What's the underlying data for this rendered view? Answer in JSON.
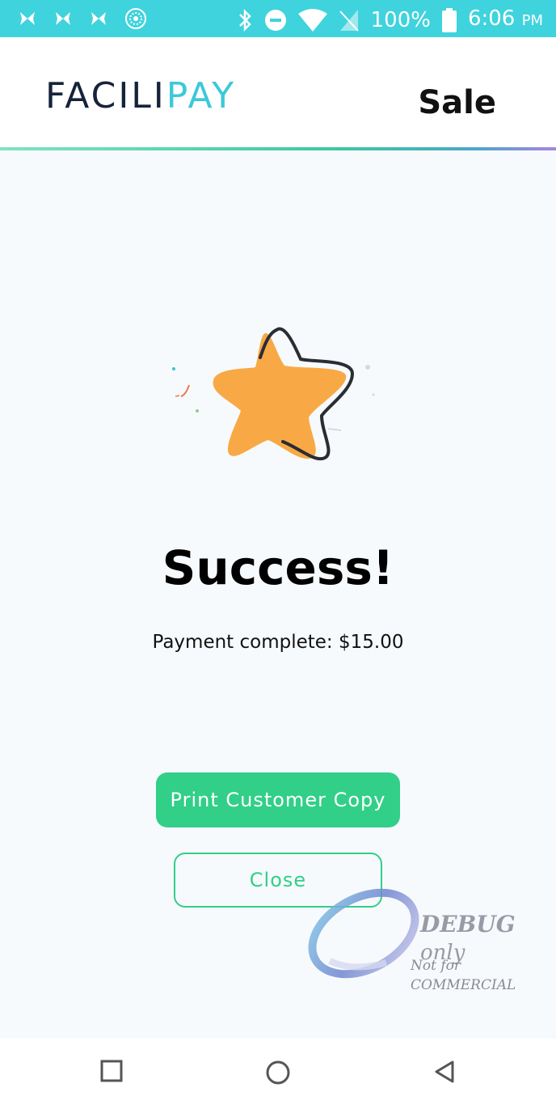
{
  "status_bar": {
    "battery_text": "100%",
    "time": "6:06",
    "ampm": "PM",
    "left_icons": [
      "butterfly-icon",
      "butterfly-icon",
      "butterfly-icon",
      "radial-icon"
    ],
    "right_icons": [
      "bluetooth-icon",
      "do-not-disturb-icon",
      "wifi-icon",
      "no-sim-icon",
      "battery-icon"
    ],
    "background_color": "#3fd3dd"
  },
  "header": {
    "logo_part1": "FACILI",
    "logo_part2": "PAY",
    "title": "Sale",
    "logo_dark_color": "#16233a",
    "logo_accent_color": "#3cc9d8"
  },
  "main": {
    "illustration": "star-icon",
    "heading": "Success!",
    "message": "Payment complete: $15.00"
  },
  "buttons": {
    "print_label": "Print Customer Copy",
    "close_label": "Close",
    "accent_color": "#31cf88"
  },
  "watermark": {
    "line1_main": "DEBUG",
    "line1_suffix": "only",
    "line2": "Not for COMMERCIAL"
  },
  "nav_bar": {
    "icons": [
      "recents-square-icon",
      "home-circle-icon",
      "back-triangle-icon"
    ]
  }
}
